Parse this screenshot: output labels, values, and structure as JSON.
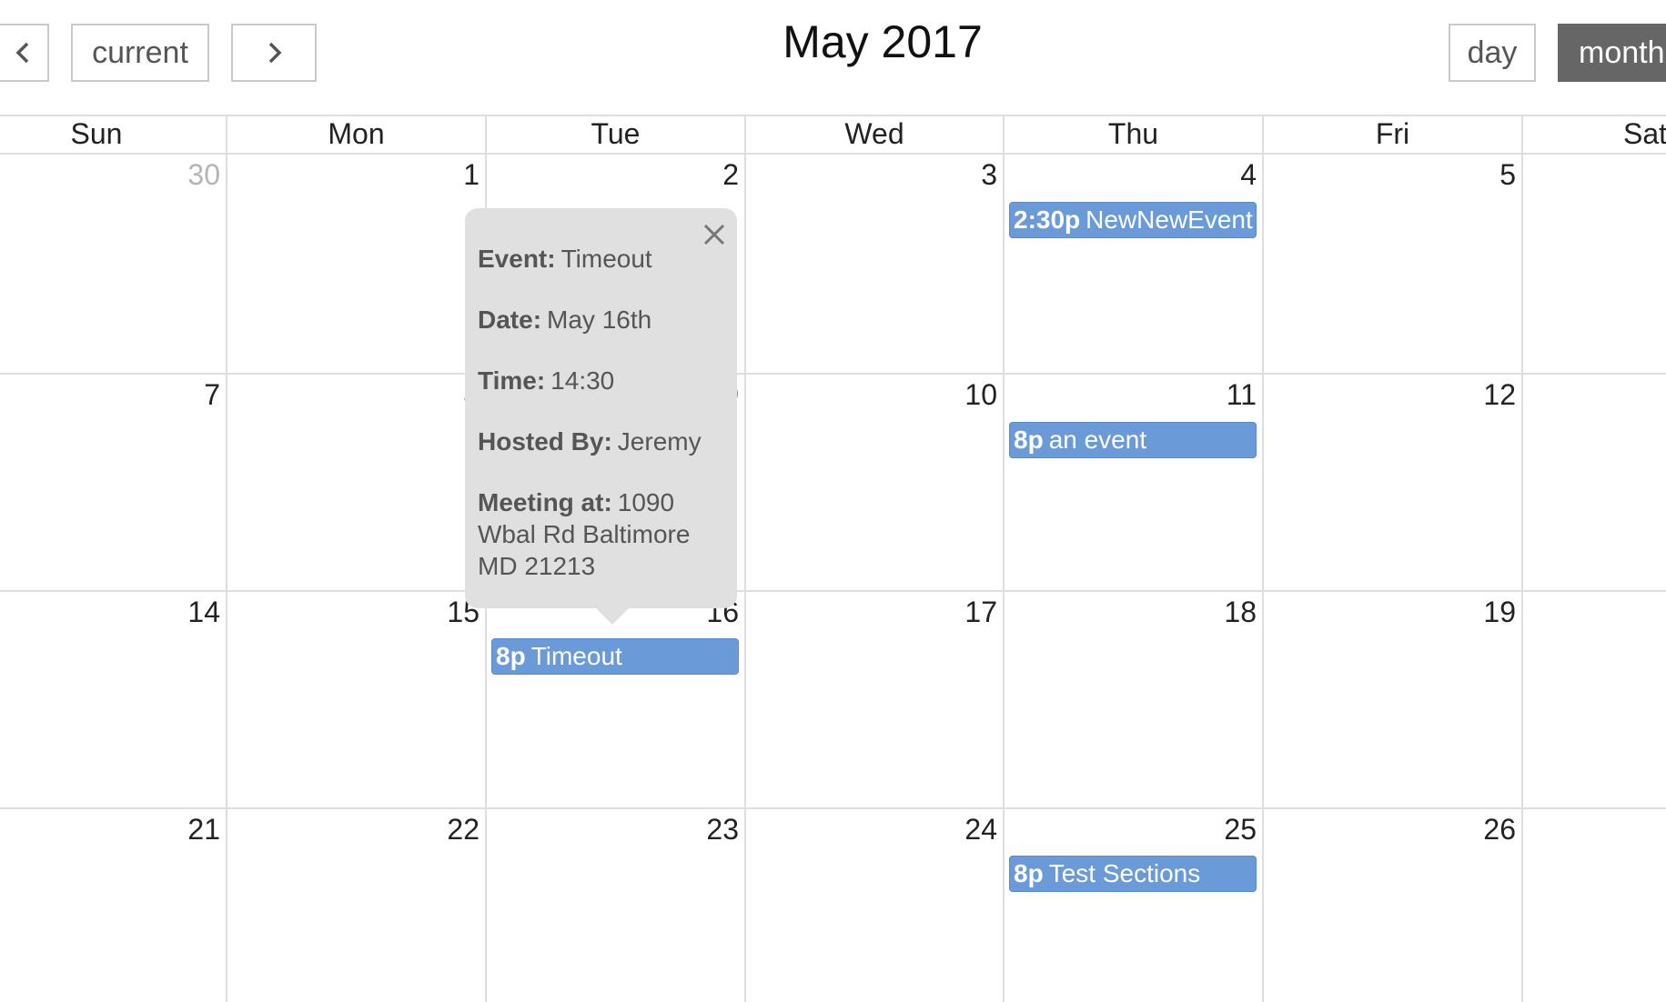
{
  "toolbar": {
    "current_label": "current",
    "day_label": "day",
    "month_label": "month",
    "title": "May 2017"
  },
  "weekdays": [
    "Sun",
    "Mon",
    "Tue",
    "Wed",
    "Thu",
    "Fri",
    "Sat"
  ],
  "weeks": [
    [
      "30",
      "1",
      "2",
      "3",
      "4",
      "5",
      ""
    ],
    [
      "7",
      "8",
      "9",
      "10",
      "11",
      "12",
      ""
    ],
    [
      "14",
      "15",
      "16",
      "17",
      "18",
      "19",
      ""
    ],
    [
      "21",
      "22",
      "23",
      "24",
      "25",
      "26",
      ""
    ]
  ],
  "events": [
    {
      "time": "2:30p",
      "title": "NewNewEvent"
    },
    {
      "time": "8p",
      "title": "an event"
    },
    {
      "time": "8p",
      "title": "Timeout"
    },
    {
      "time": "8p",
      "title": "Test Sections"
    }
  ],
  "popover": {
    "event_label": "Event:",
    "event_value": "Timeout",
    "date_label": "Date:",
    "date_value": "May 16th",
    "time_label": "Time:",
    "time_value": "14:30",
    "host_label": "Hosted By:",
    "host_value": "Jeremy",
    "location_label": "Meeting at:",
    "location_value": "1090 Wbal Rd Baltimore MD 21213"
  },
  "colors": {
    "event_bg": "#6a9bd8",
    "active_button_bg": "#666666",
    "popover_bg": "#e0e0e0"
  },
  "icons": {
    "prev": "chevron-left-icon",
    "next": "chevron-right-icon",
    "close": "close-icon"
  }
}
